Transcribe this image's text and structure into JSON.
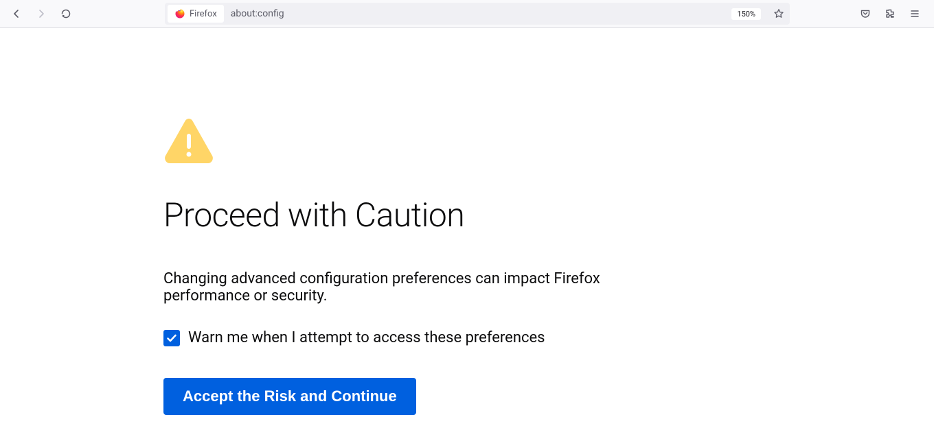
{
  "toolbar": {
    "identity_label": "Firefox",
    "url": "about:config",
    "zoom": "150%"
  },
  "content": {
    "title": "Proceed with Caution",
    "description": "Changing advanced configuration preferences can impact Firefox performance or security.",
    "checkbox_label": "Warn me when I attempt to access these preferences",
    "checkbox_checked": true,
    "accept_button": "Accept the Risk and Continue"
  }
}
